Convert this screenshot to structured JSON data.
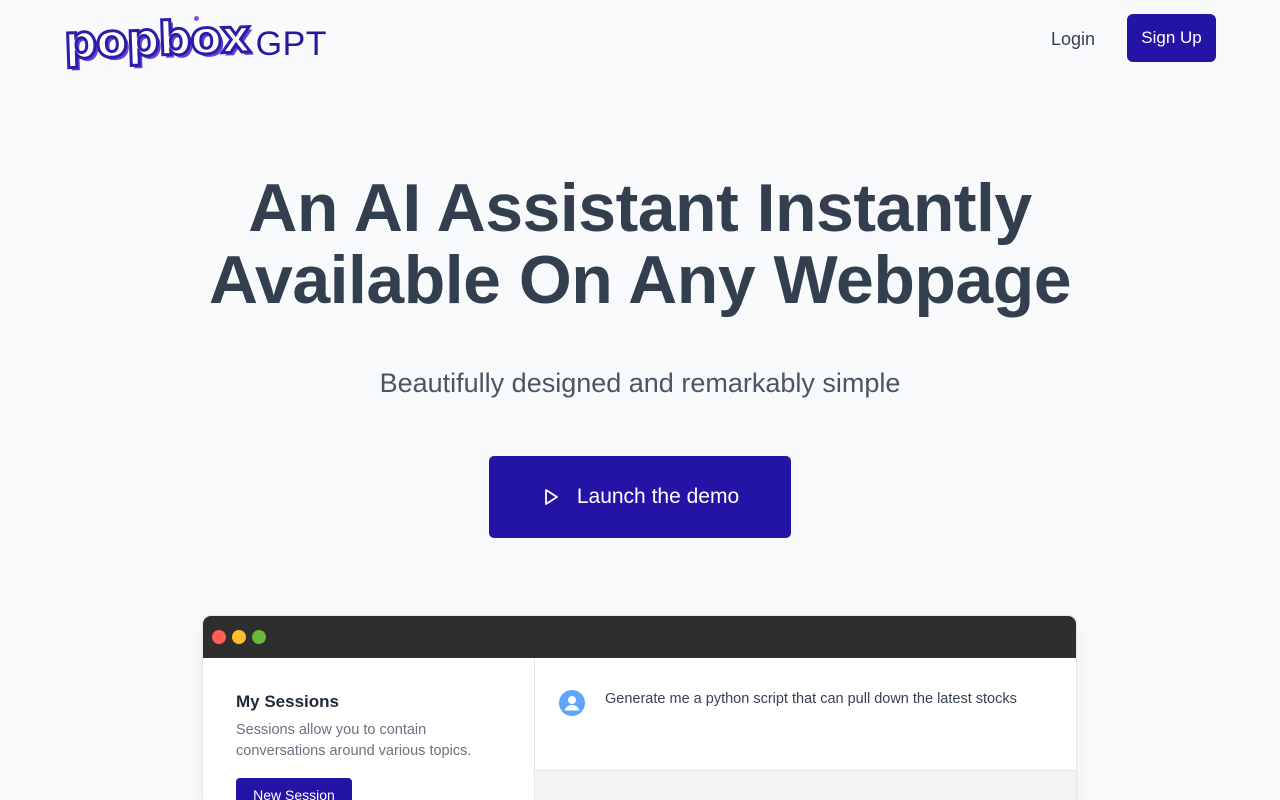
{
  "header": {
    "logo_word": "popbox",
    "logo_suffix": "GPT",
    "login_label": "Login",
    "signup_label": "Sign Up"
  },
  "hero": {
    "title_line1": "An AI Assistant Instantly",
    "title_line2": "Available On Any Webpage",
    "subtitle": "Beautifully designed and remarkably simple",
    "cta_label": "Launch the demo",
    "cta_icon": "play-icon"
  },
  "preview": {
    "window_controls": [
      {
        "name": "close",
        "color": "#ff5f57"
      },
      {
        "name": "minimize",
        "color": "#febc2e"
      },
      {
        "name": "maximize",
        "color": "#6ab83a"
      }
    ],
    "sessions": {
      "title": "My Sessions",
      "description": "Sessions allow you to contain conversations around various topics.",
      "new_session_label": "New Session"
    },
    "chat": {
      "user_icon": "user-avatar-icon",
      "message": "Generate me a python script that can pull down the latest stocks"
    }
  },
  "colors": {
    "brand": "#2314a6",
    "heading": "#333e4f",
    "background": "#f9fafb",
    "titlebar": "#2e2e2e",
    "avatar": "#60a5fa"
  }
}
